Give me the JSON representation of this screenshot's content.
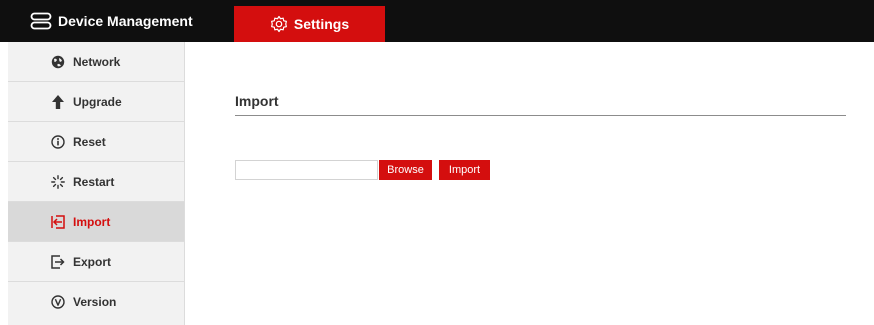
{
  "header": {
    "tabs": [
      {
        "label": "Device Management",
        "icon": "storage-icon",
        "active": false
      },
      {
        "label": "Settings",
        "icon": "gear-icon",
        "active": true
      }
    ]
  },
  "sidebar": {
    "items": [
      {
        "label": "Network",
        "icon": "globe-icon",
        "active": false
      },
      {
        "label": "Upgrade",
        "icon": "arrow-up-icon",
        "active": false
      },
      {
        "label": "Reset",
        "icon": "info-circle-icon",
        "active": false
      },
      {
        "label": "Restart",
        "icon": "spinner-icon",
        "active": false
      },
      {
        "label": "Import",
        "icon": "import-icon",
        "active": true
      },
      {
        "label": "Export",
        "icon": "export-icon",
        "active": false
      },
      {
        "label": "Version",
        "icon": "version-circle-icon",
        "active": false
      }
    ]
  },
  "main": {
    "title": "Import",
    "file_input": {
      "value": "",
      "placeholder": ""
    },
    "browse_label": "Browse",
    "import_label": "Import"
  },
  "colors": {
    "accent": "#d40e0e",
    "topbar": "#0f0f0f",
    "sidebar_bg": "#f2f2f2",
    "sidebar_active_bg": "#d9d9d9"
  }
}
